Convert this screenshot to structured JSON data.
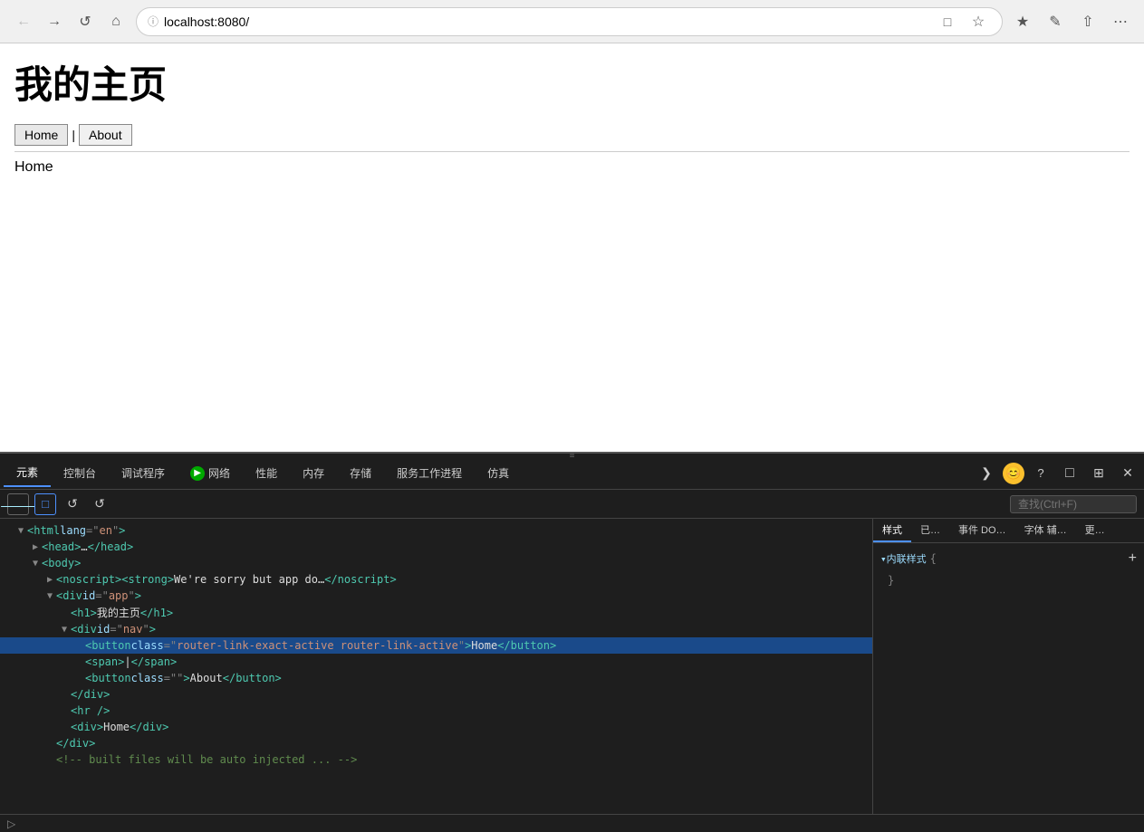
{
  "browser": {
    "back_btn": "←",
    "forward_btn": "→",
    "reload_btn": "↺",
    "home_btn": "⌂",
    "address": "localhost:8080/",
    "security_icon": "ⓘ",
    "split_btn": "⊟",
    "star_btn": "☆",
    "collections_btn": "★",
    "annotate_btn": "✎",
    "share_btn": "⇪",
    "more_btn": "⋯"
  },
  "page": {
    "title": "我的主页",
    "nav": {
      "home_label": "Home",
      "separator": "|",
      "about_label": "About"
    },
    "content": "Home"
  },
  "devtools": {
    "tabs": [
      {
        "id": "elements",
        "label": "元素",
        "active": true
      },
      {
        "id": "console",
        "label": "控制台"
      },
      {
        "id": "debugger",
        "label": "调试程序"
      },
      {
        "id": "network",
        "label": "网络",
        "has_icon": true
      },
      {
        "id": "performance",
        "label": "性能"
      },
      {
        "id": "memory",
        "label": "内存"
      },
      {
        "id": "storage",
        "label": "存储"
      },
      {
        "id": "serviceworker",
        "label": "服务工作进程"
      },
      {
        "id": "simulation",
        "label": "仿真"
      }
    ],
    "action_icons": {
      "console_drawer": "⊞",
      "emoji": "😊",
      "help": "?",
      "layout": "□",
      "dock": "⊡",
      "close": "✕"
    },
    "search_placeholder": "查找(Ctrl+F)",
    "toolbar": {
      "inspect_btn": "⊹",
      "device_btn": "⊡",
      "refresh_btn": "↺",
      "snapshot_btn": "⊞"
    },
    "dom": {
      "lines": [
        {
          "indent": 0,
          "toggle": "open",
          "content": "<html lang=\"en\">",
          "tag_open": "<html",
          "attrs": [
            {
              "name": "lang",
              "value": "\"en\""
            }
          ],
          "tag_close": ">",
          "id": "html"
        },
        {
          "indent": 1,
          "toggle": "closed",
          "content": "<head>…</head>",
          "tag_open": "<head>",
          "tag_close": "…</head>",
          "id": "head"
        },
        {
          "indent": 1,
          "toggle": "open",
          "content": "<body>",
          "tag_open": "<body>",
          "id": "body"
        },
        {
          "indent": 2,
          "toggle": "closed",
          "content": "<noscript><strong>We're sorry but app do…</noscript>",
          "id": "noscript"
        },
        {
          "indent": 2,
          "toggle": "open",
          "content": "<div id=\"app\">",
          "id": "app-div"
        },
        {
          "indent": 3,
          "toggle": "leaf",
          "content": "<h1>我的主页</h1>",
          "id": "h1"
        },
        {
          "indent": 3,
          "toggle": "open",
          "content": "<div id=\"nav\">",
          "id": "nav-div",
          "selected": true
        },
        {
          "indent": 4,
          "toggle": "leaf",
          "content": "<button class=\"router-link-exact-active router-link-active\">Home</button>",
          "id": "home-btn",
          "selected": true
        },
        {
          "indent": 4,
          "toggle": "leaf",
          "content": "<span>|</span>",
          "id": "span-sep"
        },
        {
          "indent": 4,
          "toggle": "leaf",
          "content": "<button class=\"\">About</button>",
          "id": "about-btn"
        },
        {
          "indent": 3,
          "toggle": "leaf",
          "content": "</div>",
          "id": "close-nav"
        },
        {
          "indent": 3,
          "toggle": "leaf",
          "content": "<hr />",
          "id": "hr"
        },
        {
          "indent": 3,
          "toggle": "leaf",
          "content": "<div>Home</div>",
          "id": "content-div"
        },
        {
          "indent": 2,
          "toggle": "leaf",
          "content": "</div>",
          "id": "close-app"
        },
        {
          "indent": 2,
          "toggle": "leaf",
          "content": "<!-- built files will be auto injected ... -->",
          "id": "comment",
          "partial": true
        }
      ]
    },
    "styles_panel": {
      "tabs": [
        {
          "id": "styles",
          "label": "样式",
          "active": true
        },
        {
          "id": "computed",
          "label": "已…"
        },
        {
          "id": "events",
          "label": "事件 DO…"
        },
        {
          "id": "fonts",
          "label": "字体 辅…"
        },
        {
          "id": "more",
          "label": "更…"
        }
      ],
      "inline_styles": {
        "label": "▾内联样式",
        "open_brace": "{",
        "close_brace": "}",
        "text_color": "#9cdcfe"
      }
    }
  }
}
